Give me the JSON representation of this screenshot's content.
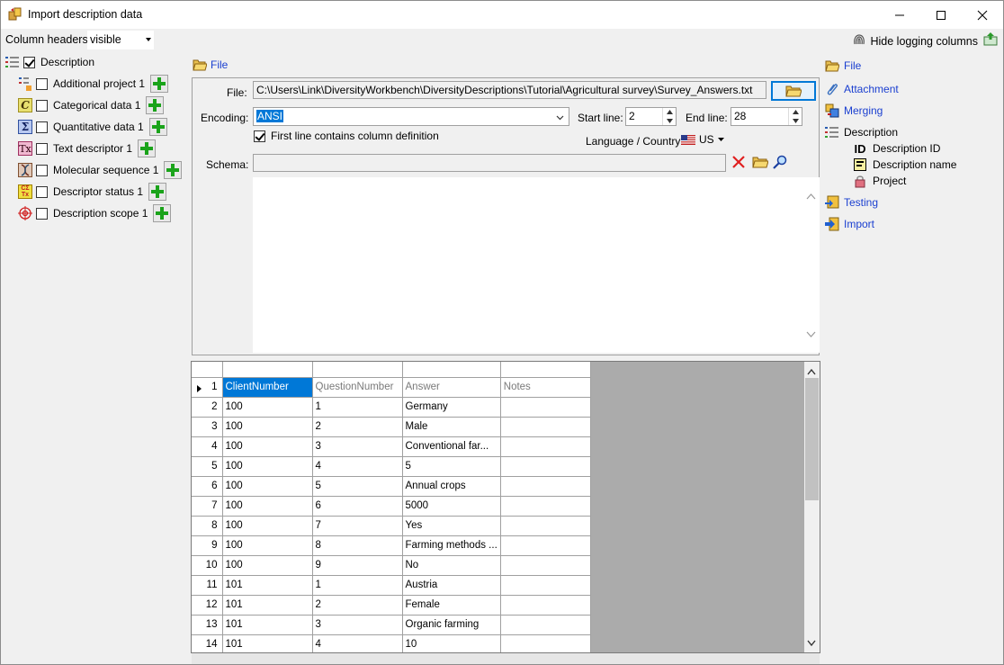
{
  "window": {
    "title": "Import description data"
  },
  "toolbar": {
    "column_headers_label": "Column headers",
    "column_headers_value": "visible",
    "hide_logging_label": "Hide logging columns"
  },
  "left_tree": {
    "root_label": "Description",
    "items": [
      {
        "label": "Additional project 1",
        "icon": "additional-project-icon"
      },
      {
        "label": "Categorical data 1",
        "icon": "categorical-data-icon"
      },
      {
        "label": "Quantitative data 1",
        "icon": "quantitative-data-icon"
      },
      {
        "label": "Text descriptor 1",
        "icon": "text-descriptor-icon"
      },
      {
        "label": "Molecular sequence 1",
        "icon": "molecular-sequence-icon"
      },
      {
        "label": "Descriptor status 1",
        "icon": "descriptor-status-icon"
      },
      {
        "label": "Description scope 1",
        "icon": "description-scope-icon"
      }
    ]
  },
  "file_section": {
    "header_label": "File",
    "file_label": "File:",
    "file_path": "C:\\Users\\Link\\DiversityWorkbench\\DiversityDescriptions\\Tutorial\\Agricultural survey\\Survey_Answers.txt",
    "encoding_label": "Encoding:",
    "encoding_value": "ANSI",
    "start_line_label": "Start line:",
    "start_line_value": "2",
    "end_line_label": "End line:",
    "end_line_value": "28",
    "first_line_label": "First line contains column definition",
    "language_label": "Language / Country:",
    "language_value": "US",
    "schema_label": "Schema:",
    "schema_value": ""
  },
  "grid": {
    "columns": [
      "ClientNumber",
      "QuestionNumber",
      "Answer",
      "Notes"
    ],
    "rows": [
      {
        "n": "2",
        "cells": [
          "100",
          "1",
          "Germany",
          ""
        ]
      },
      {
        "n": "3",
        "cells": [
          "100",
          "2",
          "Male",
          ""
        ]
      },
      {
        "n": "4",
        "cells": [
          "100",
          "3",
          "Conventional far...",
          ""
        ]
      },
      {
        "n": "5",
        "cells": [
          "100",
          "4",
          "5",
          ""
        ]
      },
      {
        "n": "6",
        "cells": [
          "100",
          "5",
          "Annual crops",
          ""
        ]
      },
      {
        "n": "7",
        "cells": [
          "100",
          "6",
          "5000",
          ""
        ]
      },
      {
        "n": "8",
        "cells": [
          "100",
          "7",
          "Yes",
          ""
        ]
      },
      {
        "n": "9",
        "cells": [
          "100",
          "8",
          "Farming methods ...",
          ""
        ]
      },
      {
        "n": "10",
        "cells": [
          "100",
          "9",
          "No",
          ""
        ]
      },
      {
        "n": "11",
        "cells": [
          "101",
          "1",
          "Austria",
          ""
        ]
      },
      {
        "n": "12",
        "cells": [
          "101",
          "2",
          "Female",
          ""
        ]
      },
      {
        "n": "13",
        "cells": [
          "101",
          "3",
          "Organic farming",
          ""
        ]
      },
      {
        "n": "14",
        "cells": [
          "101",
          "4",
          "10",
          ""
        ]
      }
    ],
    "header_row_number": "1"
  },
  "right_tree": {
    "file": "File",
    "attachment": "Attachment",
    "merging": "Merging",
    "description": "Description",
    "description_id": "Description ID",
    "description_name": "Description name",
    "project": "Project",
    "testing": "Testing",
    "import": "Import"
  },
  "colors": {
    "link": "#1a3fd0",
    "selection": "#0078d7",
    "add_green": "#1aa31a"
  }
}
